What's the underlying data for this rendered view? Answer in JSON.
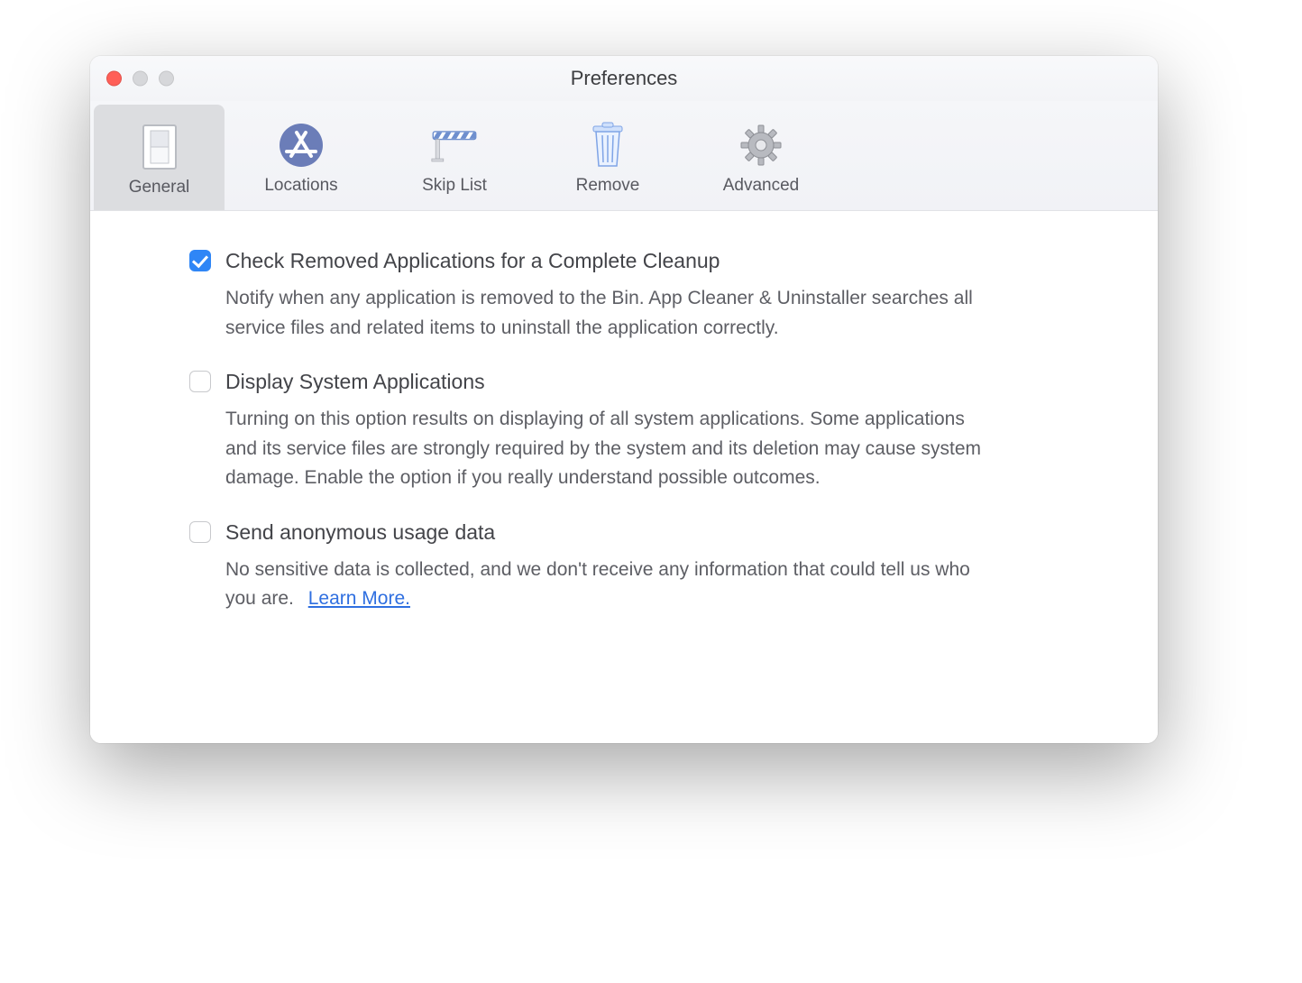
{
  "window": {
    "title": "Preferences"
  },
  "toolbar": {
    "tabs": [
      {
        "label": "General",
        "active": true
      },
      {
        "label": "Locations",
        "active": false
      },
      {
        "label": "Skip List",
        "active": false
      },
      {
        "label": "Remove",
        "active": false
      },
      {
        "label": "Advanced",
        "active": false
      }
    ]
  },
  "options": [
    {
      "checked": true,
      "title": "Check Removed Applications for a Complete Cleanup",
      "desc": "Notify when any application is removed to the Bin. App Cleaner & Uninstaller searches all service files and related items to uninstall the application correctly."
    },
    {
      "checked": false,
      "title": "Display System Applications",
      "desc": "Turning on this option results on displaying of all system applications. Some applications and its service files are strongly required by the system and its deletion may cause system damage. Enable the option if you really understand possible outcomes."
    },
    {
      "checked": false,
      "title": "Send anonymous usage data",
      "desc": "No sensitive data is collected, and we don't receive any information that could tell us who you are.",
      "link_label": "Learn More."
    }
  ]
}
